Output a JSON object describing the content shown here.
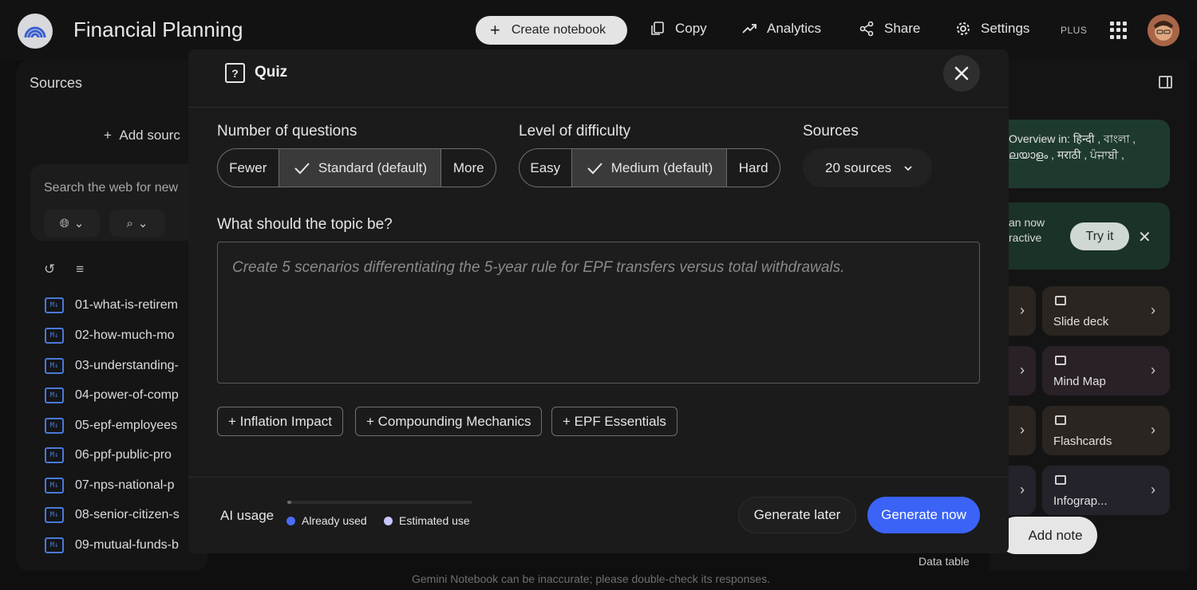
{
  "header": {
    "title": "Financial Planning",
    "create_label": "Create notebook",
    "copy_label": "Copy",
    "analytics_label": "Analytics",
    "share_label": "Share",
    "settings_label": "Settings",
    "plan_badge": "PLUS"
  },
  "sources_panel": {
    "title": "Sources",
    "add_label": "Add sourc",
    "search_placeholder": "Search the web for new",
    "items": [
      {
        "label": "01-what-is-retirem",
        "icon": "markdown-file-icon"
      },
      {
        "label": "02-how-much-mo",
        "icon": "markdown-file-icon"
      },
      {
        "label": "03-understanding-",
        "icon": "markdown-file-icon"
      },
      {
        "label": "04-power-of-comp",
        "icon": "markdown-file-icon"
      },
      {
        "label": "05-epf-employees",
        "icon": "markdown-file-icon"
      },
      {
        "label": "06-ppf-public-pro",
        "icon": "markdown-file-icon"
      },
      {
        "label": "07-nps-national-p",
        "icon": "markdown-file-icon"
      },
      {
        "label": "08-senior-citizen-s",
        "icon": "markdown-file-icon"
      },
      {
        "label": "09-mutual-funds-b",
        "icon": "markdown-file-icon"
      }
    ]
  },
  "studio_panel": {
    "overview_line1": "Overview in: हिन्दी , বাংলা ,",
    "overview_line2": "ലയാളം , मराठी , ਪੰਜਾਬੀ ,",
    "tryit_line1": "an now",
    "tryit_line2": "ractive",
    "tryit_label": "Try it",
    "tools": [
      {
        "label": "Slide deck",
        "icon": "slide-deck-icon",
        "color": "#2a2520"
      },
      {
        "label": "Mind Map",
        "icon": "mind-map-icon",
        "color": "#2a2028"
      },
      {
        "label": "Flashcards",
        "icon": "flashcards-icon",
        "color": "#2a2520"
      },
      {
        "label": "Infograp...",
        "icon": "infographic-icon",
        "color": "#24222a"
      }
    ],
    "add_note_label": "Add note",
    "data_table_label": "Data table"
  },
  "footer_note": "Gemini Notebook can be inaccurate; please double-check its responses.",
  "quiz": {
    "title": "Quiz",
    "questions_label": "Number of questions",
    "questions_options": [
      "Fewer",
      "Standard (default)",
      "More"
    ],
    "questions_selected": "Standard (default)",
    "difficulty_label": "Level of difficulty",
    "difficulty_options": [
      "Easy",
      "Medium (default)",
      "Hard"
    ],
    "difficulty_selected": "Medium (default)",
    "sources_label": "Sources",
    "sources_value": "20 sources",
    "topic_label": "What should the topic be?",
    "topic_placeholder": "Create 5 scenarios differentiating the 5-year rule for EPF transfers versus total withdrawals.",
    "suggestions": [
      "+ Inflation Impact",
      "+ Compounding Mechanics",
      "+ EPF Essentials"
    ],
    "ai_usage_label": "AI usage",
    "usage_fraction": 0.02,
    "legend_used": "Already used",
    "legend_estimated": "Estimated use",
    "generate_later_label": "Generate later",
    "generate_now_label": "Generate now"
  },
  "colors": {
    "accent": "#3b63f6",
    "used_dot": "#4a6cf7",
    "estimated_dot": "#c9c6ff"
  }
}
